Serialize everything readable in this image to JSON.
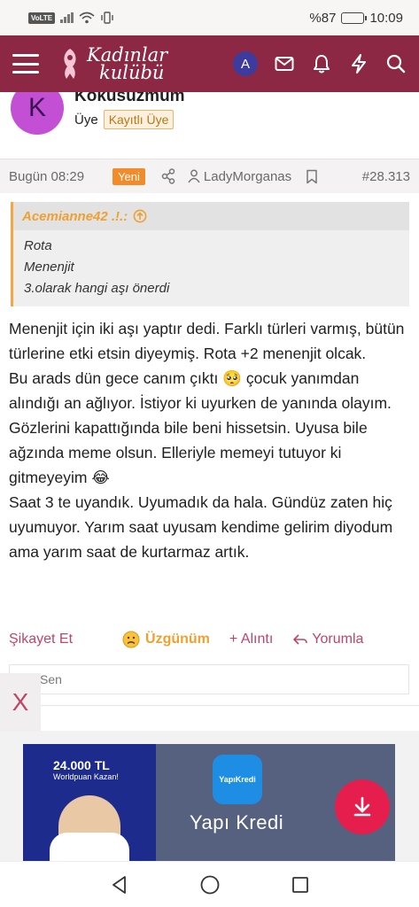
{
  "status_bar": {
    "network_label": "VoLTE",
    "battery_text": "%87",
    "battery_level_percent": 87,
    "time": "10:09"
  },
  "header": {
    "logo_line1": "Kadınlar",
    "logo_line2": "kulübü",
    "avatar_letter": "A",
    "brand_color": "#8c2843"
  },
  "post": {
    "avatar_letter": "K",
    "username": "Kokusuzmum",
    "role": "Üye",
    "badge": "Kayıtlı Üye",
    "time": "Bugün 08:29",
    "new_label": "Yeni",
    "quoted_user_label": "LadyMorganas",
    "post_number": "#28.313",
    "quote": {
      "author": "Acemianne42 .!.:",
      "lines": [
        "Rota",
        "Menenjit",
        "3.olarak hangi aşı önerdi"
      ]
    },
    "paragraphs": [
      "Menenjit için iki aşı yaptır dedi. Farklı türleri varmış, bütün türlerine etki etsin diyeymiş. Rota +2 menenjit olcak.",
      "Bu arads dün gece canım çıktı 🥺 çocuk yanımdan alındığı an ağlıyor. İstiyor ki uyurken de yanında olayım. Gözlerini kapattığında bile beni hissetsin. Uyusa bile ağzında meme olsun. Elleriyle memeyi tutuyor ki gitmeyeyim 😂",
      "Saat 3 te uyandık. Uyumadık da hala. Gündüz zaten hiç uyumuyor. Yarım saat uyusam kendime gelirim diyodum ama yarım saat de kurtarmaz artık."
    ],
    "actions": {
      "report": "Şikayet Et",
      "reaction": "Üzgünüm",
      "quote": "+ Alıntı",
      "reply": "Yorumla"
    },
    "reactions_text": "Sen"
  },
  "ad": {
    "close_label": "X",
    "promo_amount": "24.000 TL",
    "promo_sub": "Worldpuan Kazan!",
    "logo_text": "YapıKredi",
    "brand_text": "Yapı Kredi"
  }
}
